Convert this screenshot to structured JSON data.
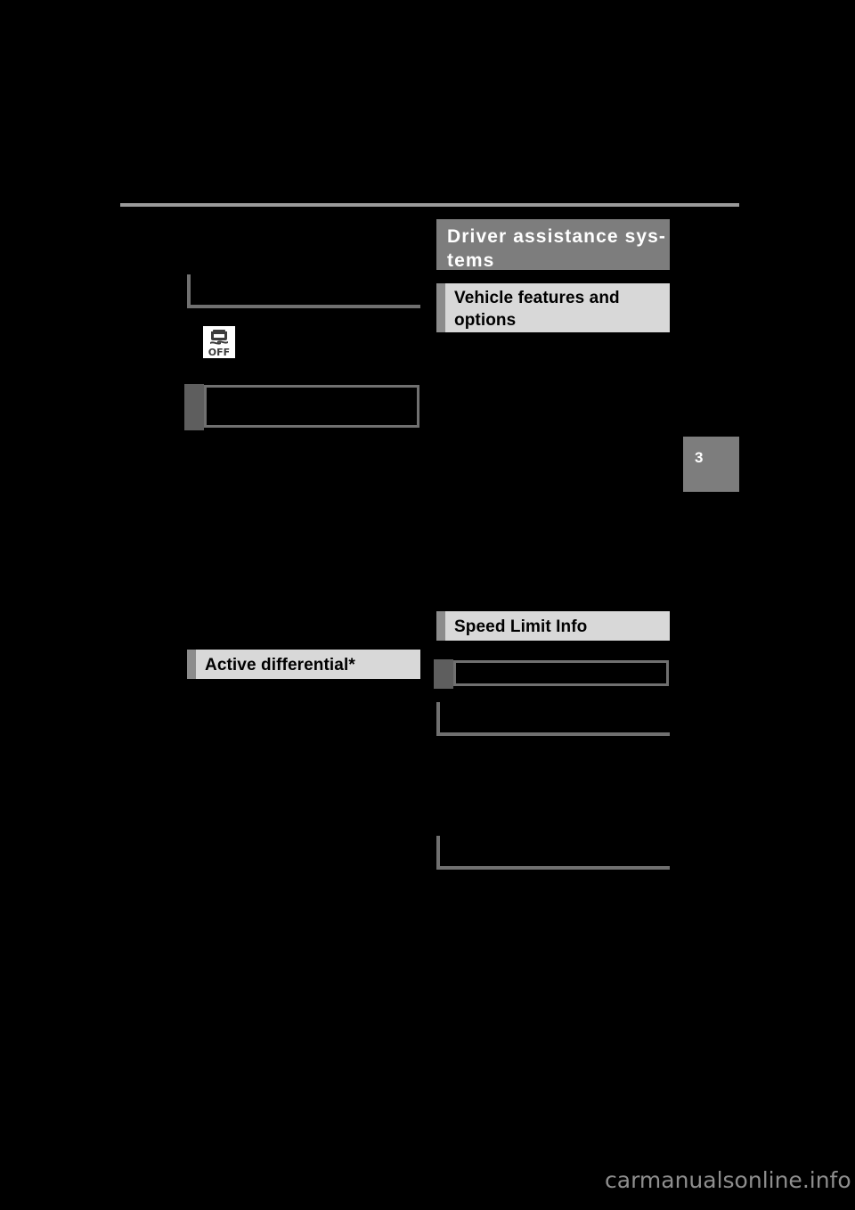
{
  "page": {
    "background_color": "#000000",
    "number": "3",
    "watermark": "carmanualsonline.info"
  },
  "colors": {
    "chapter_bar": "#7d7d7d",
    "section_bar": "#d8d8d8",
    "section_tab": "#8c8c8c",
    "rule": "#9a9a9a",
    "frame": "#707070",
    "warning_tab": "#5e5e5e",
    "text_light": "#ffffff",
    "text_dark": "#000000",
    "watermark": "#8e8e8e"
  },
  "chapter": {
    "title": "Driver assistance systems",
    "title_line_1": "Driver assistance sys-",
    "title_line_2": "tems"
  },
  "left_column": {
    "notice_rule_1": "",
    "indicator_icon": {
      "name": "vsc-off-indicator-icon",
      "label": "OFF"
    },
    "warning_box_1": "",
    "section": {
      "title": "Active differential*"
    }
  },
  "right_column": {
    "sections": [
      {
        "title": "Vehicle features and options",
        "title_line_1": "Vehicle features and",
        "title_line_2": "options"
      },
      {
        "title": "Speed Limit Info"
      }
    ],
    "warning_box_1": "",
    "notice_rule_1": "",
    "notice_rule_2": ""
  }
}
